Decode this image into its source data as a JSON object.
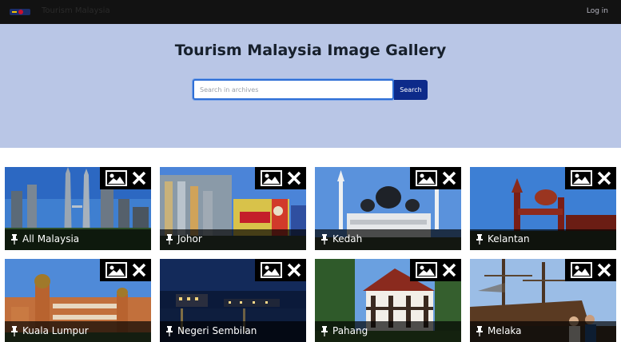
{
  "nav": {
    "brand": "Tourism Malaysia",
    "login": "Log in"
  },
  "hero": {
    "title": "Tourism Malaysia Image Gallery"
  },
  "search": {
    "placeholder": "Search in archives",
    "button": "Search"
  },
  "gallery": {
    "items": [
      {
        "label": "All Malaysia"
      },
      {
        "label": "Johor"
      },
      {
        "label": "Kedah"
      },
      {
        "label": "Kelantan"
      },
      {
        "label": "Kuala Lumpur"
      },
      {
        "label": "Negeri Sembilan"
      },
      {
        "label": "Pahang"
      },
      {
        "label": "Melaka"
      }
    ]
  },
  "colors": {
    "nav_bg": "#121212",
    "hero_bg": "#b9c6e6",
    "search_button": "#0d2a8a",
    "search_border": "#2f6fd6"
  }
}
